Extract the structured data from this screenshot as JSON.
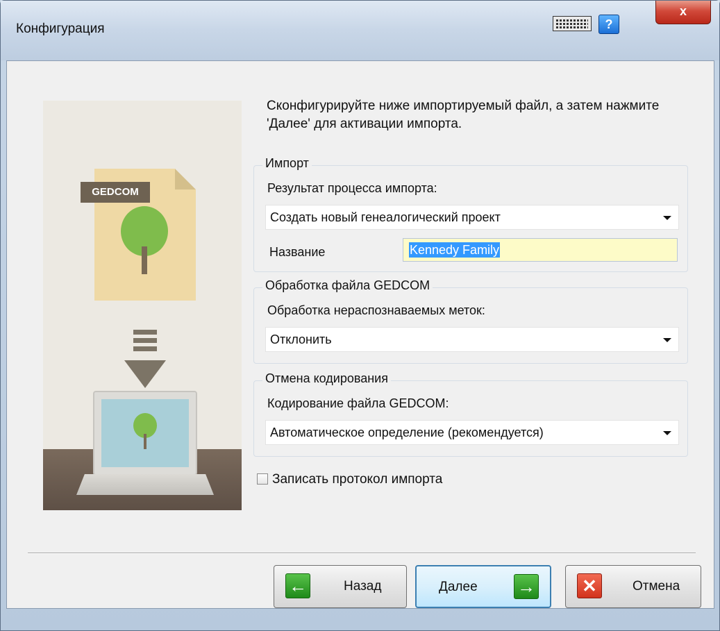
{
  "window": {
    "title": "Конфигурация",
    "help_label": "?",
    "close_label": "x"
  },
  "illustration": {
    "tag": "GEDCOM"
  },
  "intro": "Сконфигурируйте ниже импортируемый файл, а затем нажмите 'Далее' для активации импорта.",
  "import_group": {
    "title": "Импорт",
    "result_label": "Результат процесса импорта:",
    "result_value": "Создать новый генеалогический проект",
    "name_label": "Название",
    "name_value": "Kennedy Family"
  },
  "gedcom_group": {
    "title": "Обработка файла GEDCOM",
    "tags_label": "Обработка нераспознаваемых меток:",
    "tags_value": "Отклонить"
  },
  "encoding_group": {
    "title": "Отмена кодирования",
    "encoding_label": "Кодирование файла GEDCOM:",
    "encoding_value": "Автоматическое определение (рекомендуется)"
  },
  "log_checkbox": {
    "label": "Записать протокол импорта",
    "checked": false
  },
  "buttons": {
    "back": "Назад",
    "next": "Далее",
    "cancel": "Отмена"
  },
  "icons": {
    "keyboard": "keyboard-icon",
    "help": "help-icon",
    "back": "arrow-left-icon",
    "next": "arrow-right-icon",
    "cancel": "x-icon"
  },
  "colors": {
    "name_field_bg": "#fdfbc8",
    "selection": "#3399ff",
    "arrow_green": "#2a9a22",
    "cancel_red": "#d2331d"
  }
}
